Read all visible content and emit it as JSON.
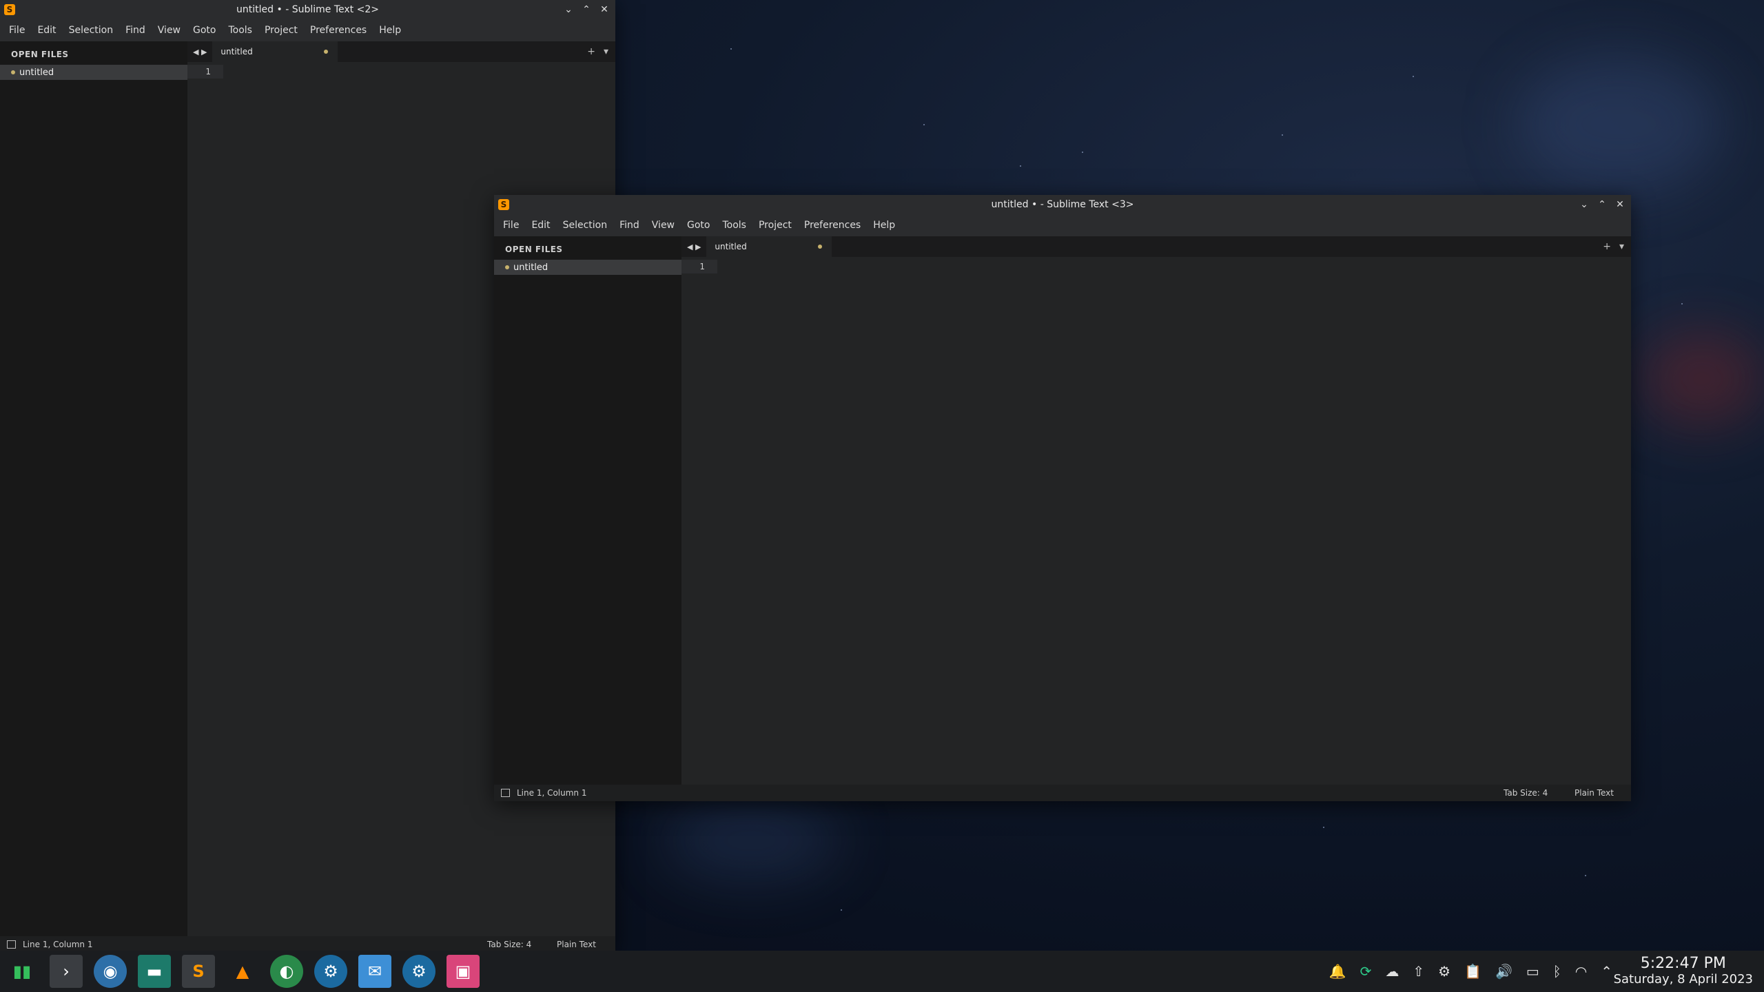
{
  "windows": [
    {
      "title": "untitled • - Sublime Text <2>",
      "menu": [
        "File",
        "Edit",
        "Selection",
        "Find",
        "View",
        "Goto",
        "Tools",
        "Project",
        "Preferences",
        "Help"
      ],
      "sidebar_header": "OPEN FILES",
      "open_file": "untitled",
      "tab_label": "untitled",
      "line_number": "1",
      "status_position": "Line 1, Column 1",
      "status_tabsize": "Tab Size: 4",
      "status_syntax": "Plain Text"
    },
    {
      "title": "untitled • - Sublime Text <3>",
      "menu": [
        "File",
        "Edit",
        "Selection",
        "Find",
        "View",
        "Goto",
        "Tools",
        "Project",
        "Preferences",
        "Help"
      ],
      "sidebar_header": "OPEN FILES",
      "open_file": "untitled",
      "tab_label": "untitled",
      "line_number": "1",
      "status_position": "Line 1, Column 1",
      "status_tabsize": "Tab Size: 4",
      "status_syntax": "Plain Text"
    }
  ],
  "taskbar": {
    "apps": [
      "manjaro-logo-icon",
      "terminal-icon",
      "browser-icon",
      "files-icon",
      "sublime-icon",
      "vlc-icon",
      "vpn-icon",
      "steam-icon",
      "mail-icon",
      "steam-icon",
      "screenshot-icon"
    ],
    "tray": [
      "notification-icon",
      "sync-icon",
      "cloud-icon",
      "update-icon",
      "steam-icon",
      "clipboard-icon",
      "volume-icon",
      "battery-icon",
      "bluetooth-icon",
      "wifi-icon",
      "chevron-up-icon"
    ],
    "time": "5:22:47 PM",
    "date": "Saturday, 8 April 2023"
  }
}
